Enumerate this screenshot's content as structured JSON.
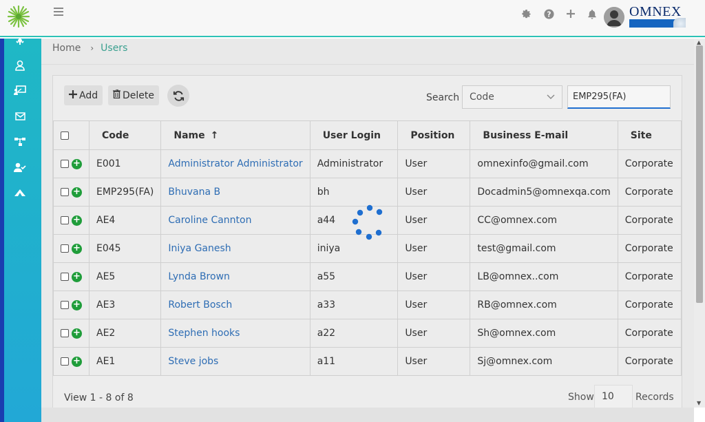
{
  "header": {
    "brand": "OMNEX",
    "icons": [
      "settings-icon",
      "help-icon",
      "add-icon",
      "notification-bell-icon",
      "user-avatar"
    ]
  },
  "sidebar": {
    "icons": [
      "gear-icon",
      "user-icon",
      "presentation-icon",
      "mail-icon",
      "hierarchy-icon",
      "user-check-icon",
      "wing-icon"
    ]
  },
  "breadcrumb": {
    "home": "Home",
    "separator": "›",
    "current": "Users"
  },
  "toolbar": {
    "add_label": "Add",
    "delete_label": "Delete",
    "search_label": "Search",
    "search_field": "Code",
    "search_value": "EMP295(FA)"
  },
  "table": {
    "columns": [
      "Code",
      "Name",
      "User Login",
      "Position",
      "Business E-mail",
      "Site"
    ],
    "sort_indicator": "↑",
    "rows": [
      {
        "code": "E001",
        "name": "Administrator Administrator",
        "login": "Administrator",
        "position": "User",
        "email": "omnexinfo@gmail.com",
        "site": "Corporate"
      },
      {
        "code": "EMP295(FA)",
        "name": "Bhuvana B",
        "login": "bh",
        "position": "User",
        "email": "Docadmin5@omnexqa.com",
        "site": "Corporate"
      },
      {
        "code": "AE4",
        "name": "Caroline Cannton",
        "login": "a44",
        "position": "User",
        "email": "CC@omnex.com",
        "site": "Corporate"
      },
      {
        "code": "E045",
        "name": "Iniya Ganesh",
        "login": "iniya",
        "position": "User",
        "email": "test@gmail.com",
        "site": "Corporate"
      },
      {
        "code": "AE5",
        "name": "Lynda Brown",
        "login": "a55",
        "position": "User",
        "email": "LB@omnex..com",
        "site": "Corporate"
      },
      {
        "code": "AE3",
        "name": "Robert Bosch",
        "login": "a33",
        "position": "User",
        "email": "RB@omnex.com",
        "site": "Corporate"
      },
      {
        "code": "AE2",
        "name": "Stephen hooks",
        "login": "a22",
        "position": "User",
        "email": "Sh@omnex.com",
        "site": "Corporate"
      },
      {
        "code": "AE1",
        "name": "Steve jobs",
        "login": "a11",
        "position": "User",
        "email": "Sj@omnex.com",
        "site": "Corporate"
      }
    ]
  },
  "footer": {
    "view_text": "View 1 - 8 of 8",
    "show_label": "Show",
    "page_size": "10",
    "records_label": "Records"
  },
  "colors": {
    "accent": "#2cc2b6",
    "link": "#2e6db4",
    "sidebar_top": "#1fb8c5",
    "sidebar_bottom": "#22a8d6",
    "add_row": "#1f9d3a",
    "spinner": "#1f6fd0"
  }
}
